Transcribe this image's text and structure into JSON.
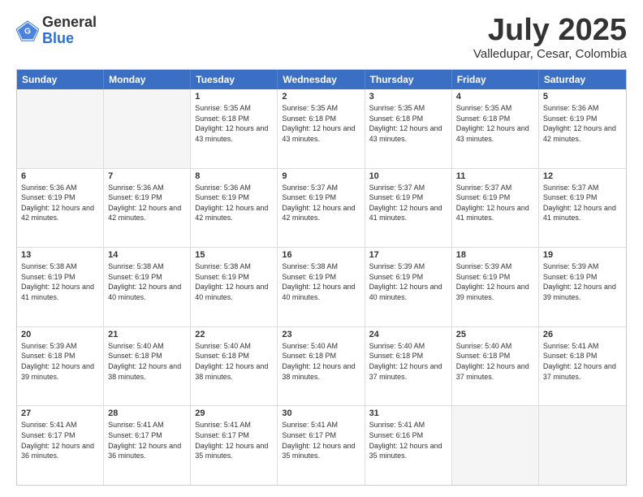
{
  "logo": {
    "general": "General",
    "blue": "Blue"
  },
  "header": {
    "month": "July 2025",
    "location": "Valledupar, Cesar, Colombia"
  },
  "days_of_week": [
    "Sunday",
    "Monday",
    "Tuesday",
    "Wednesday",
    "Thursday",
    "Friday",
    "Saturday"
  ],
  "weeks": [
    [
      {
        "day": "",
        "empty": true
      },
      {
        "day": "",
        "empty": true
      },
      {
        "day": "1",
        "sunrise": "5:35 AM",
        "sunset": "6:18 PM",
        "daylight": "12 hours and 43 minutes."
      },
      {
        "day": "2",
        "sunrise": "5:35 AM",
        "sunset": "6:18 PM",
        "daylight": "12 hours and 43 minutes."
      },
      {
        "day": "3",
        "sunrise": "5:35 AM",
        "sunset": "6:18 PM",
        "daylight": "12 hours and 43 minutes."
      },
      {
        "day": "4",
        "sunrise": "5:35 AM",
        "sunset": "6:18 PM",
        "daylight": "12 hours and 43 minutes."
      },
      {
        "day": "5",
        "sunrise": "5:36 AM",
        "sunset": "6:19 PM",
        "daylight": "12 hours and 42 minutes."
      }
    ],
    [
      {
        "day": "6",
        "sunrise": "5:36 AM",
        "sunset": "6:19 PM",
        "daylight": "12 hours and 42 minutes."
      },
      {
        "day": "7",
        "sunrise": "5:36 AM",
        "sunset": "6:19 PM",
        "daylight": "12 hours and 42 minutes."
      },
      {
        "day": "8",
        "sunrise": "5:36 AM",
        "sunset": "6:19 PM",
        "daylight": "12 hours and 42 minutes."
      },
      {
        "day": "9",
        "sunrise": "5:37 AM",
        "sunset": "6:19 PM",
        "daylight": "12 hours and 42 minutes."
      },
      {
        "day": "10",
        "sunrise": "5:37 AM",
        "sunset": "6:19 PM",
        "daylight": "12 hours and 41 minutes."
      },
      {
        "day": "11",
        "sunrise": "5:37 AM",
        "sunset": "6:19 PM",
        "daylight": "12 hours and 41 minutes."
      },
      {
        "day": "12",
        "sunrise": "5:37 AM",
        "sunset": "6:19 PM",
        "daylight": "12 hours and 41 minutes."
      }
    ],
    [
      {
        "day": "13",
        "sunrise": "5:38 AM",
        "sunset": "6:19 PM",
        "daylight": "12 hours and 41 minutes."
      },
      {
        "day": "14",
        "sunrise": "5:38 AM",
        "sunset": "6:19 PM",
        "daylight": "12 hours and 40 minutes."
      },
      {
        "day": "15",
        "sunrise": "5:38 AM",
        "sunset": "6:19 PM",
        "daylight": "12 hours and 40 minutes."
      },
      {
        "day": "16",
        "sunrise": "5:38 AM",
        "sunset": "6:19 PM",
        "daylight": "12 hours and 40 minutes."
      },
      {
        "day": "17",
        "sunrise": "5:39 AM",
        "sunset": "6:19 PM",
        "daylight": "12 hours and 40 minutes."
      },
      {
        "day": "18",
        "sunrise": "5:39 AM",
        "sunset": "6:19 PM",
        "daylight": "12 hours and 39 minutes."
      },
      {
        "day": "19",
        "sunrise": "5:39 AM",
        "sunset": "6:19 PM",
        "daylight": "12 hours and 39 minutes."
      }
    ],
    [
      {
        "day": "20",
        "sunrise": "5:39 AM",
        "sunset": "6:18 PM",
        "daylight": "12 hours and 39 minutes."
      },
      {
        "day": "21",
        "sunrise": "5:40 AM",
        "sunset": "6:18 PM",
        "daylight": "12 hours and 38 minutes."
      },
      {
        "day": "22",
        "sunrise": "5:40 AM",
        "sunset": "6:18 PM",
        "daylight": "12 hours and 38 minutes."
      },
      {
        "day": "23",
        "sunrise": "5:40 AM",
        "sunset": "6:18 PM",
        "daylight": "12 hours and 38 minutes."
      },
      {
        "day": "24",
        "sunrise": "5:40 AM",
        "sunset": "6:18 PM",
        "daylight": "12 hours and 37 minutes."
      },
      {
        "day": "25",
        "sunrise": "5:40 AM",
        "sunset": "6:18 PM",
        "daylight": "12 hours and 37 minutes."
      },
      {
        "day": "26",
        "sunrise": "5:41 AM",
        "sunset": "6:18 PM",
        "daylight": "12 hours and 37 minutes."
      }
    ],
    [
      {
        "day": "27",
        "sunrise": "5:41 AM",
        "sunset": "6:17 PM",
        "daylight": "12 hours and 36 minutes."
      },
      {
        "day": "28",
        "sunrise": "5:41 AM",
        "sunset": "6:17 PM",
        "daylight": "12 hours and 36 minutes."
      },
      {
        "day": "29",
        "sunrise": "5:41 AM",
        "sunset": "6:17 PM",
        "daylight": "12 hours and 35 minutes."
      },
      {
        "day": "30",
        "sunrise": "5:41 AM",
        "sunset": "6:17 PM",
        "daylight": "12 hours and 35 minutes."
      },
      {
        "day": "31",
        "sunrise": "5:41 AM",
        "sunset": "6:16 PM",
        "daylight": "12 hours and 35 minutes."
      },
      {
        "day": "",
        "empty": true
      },
      {
        "day": "",
        "empty": true
      }
    ]
  ]
}
